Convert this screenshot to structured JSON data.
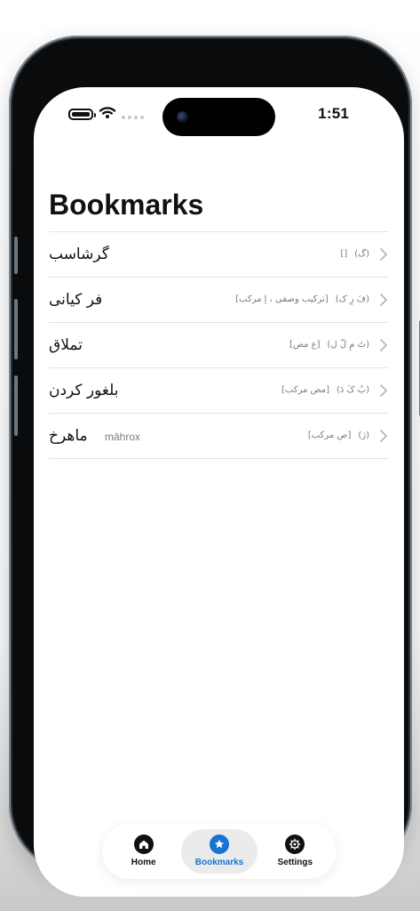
{
  "status_bar": {
    "time": "1:51",
    "icons": [
      "battery-icon",
      "wifi-icon",
      "signal-dots-icon"
    ]
  },
  "page": {
    "title": "Bookmarks"
  },
  "bookmarks": [
    {
      "word": "گرشاسب",
      "transliteration": "",
      "pronunciation": "(گ)",
      "grammar": "[]"
    },
    {
      "word": "فر کیانی",
      "transliteration": "",
      "pronunciation": "(فَ رِ ک)",
      "grammar": "[ترکیب وصفی ، إ مرکب]"
    },
    {
      "word": "تملاق",
      "transliteration": "",
      "pronunciation": "(تَ مِ لّ ل)",
      "grammar": "[ع مص]"
    },
    {
      "word": "بلغور کردن",
      "transliteration": "",
      "pronunciation": "(بُ کَ دَ)",
      "grammar": "[مص مرکب]"
    },
    {
      "word": "ماهرخ",
      "transliteration": "māhrox",
      "pronunciation": "(ژ)",
      "grammar": "[ص مرکب]"
    }
  ],
  "tab_bar": {
    "tabs": [
      {
        "label": "Home",
        "icon": "home-icon",
        "active": false
      },
      {
        "label": "Bookmarks",
        "icon": "star-icon",
        "active": true
      },
      {
        "label": "Settings",
        "icon": "gear-icon",
        "active": false
      }
    ]
  },
  "colors": {
    "accent": "#1674d2",
    "active_tab_background": "#ebebeb",
    "text_primary": "#111111",
    "text_secondary": "#7a7a7a",
    "separator": "#e3e3e3"
  }
}
